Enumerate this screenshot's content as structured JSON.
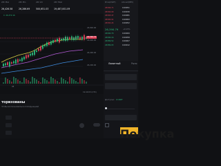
{
  "ticker": {
    "price": "26,390.79",
    "change": "+0.15%",
    "stats_labels": [
      "24h Max",
      "24h Min",
      "24h Vol",
      "24h Total"
    ],
    "stats_values": [
      "26,426.58",
      "26,286.69",
      "500,651.03",
      "19,487,001.09"
    ],
    "vol_value": "45,878,234.77"
  },
  "chart": {
    "pair_label": "C: 26,372.16",
    "y_labels": [
      "26,800.00",
      "26,600.00",
      "26,400.00",
      "26,200.00",
      "26,000.00"
    ],
    "current_price_tag": "26,390.79",
    "x_label": "08",
    "time_label": "19:40:03 (UTC)"
  },
  "orderbook": {
    "header": [
      "Price(USDT)",
      "Amount(BTC)"
    ],
    "asks": [
      {
        "price": "26394.71",
        "amount": "0.00051"
      },
      {
        "price": "26394.09",
        "amount": "0.00030"
      },
      {
        "price": "26393.47",
        "amount": "0.00081"
      },
      {
        "price": "26392.91",
        "amount": "0.00093"
      },
      {
        "price": "26392.24",
        "amount": "0.00052"
      }
    ],
    "bids": [
      {
        "price": "26390.79",
        "amount": "0.00000"
      },
      {
        "price": "26390.16",
        "amount": "0.00058"
      },
      {
        "price": "26389.52",
        "amount": "0.00007"
      },
      {
        "price": "26389.03",
        "amount": "0.00012"
      }
    ]
  },
  "order_form": {
    "tab_limit": "Лимитный",
    "tab_market": "Рыно",
    "available_label": "Доступно:",
    "available_value": "0 USDT",
    "buy_button": "Покупка"
  },
  "bottom": {
    "title": "торизованы",
    "subtitle": "Чтобы воспользоваться этой функцией"
  },
  "colors": {
    "green": "#2bbd7e",
    "red": "#e0435a",
    "accent": "#f0b429",
    "buy_button": "#f0b429"
  }
}
